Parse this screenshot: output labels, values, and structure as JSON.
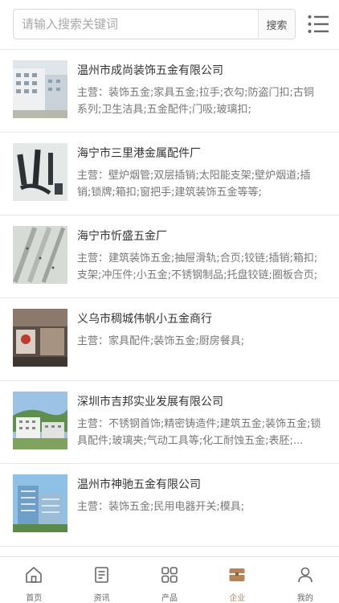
{
  "search": {
    "placeholder": "请输入搜索关键词",
    "button_label": "搜索"
  },
  "companies": [
    {
      "name": "温州市成尚装饰五金有限公司",
      "description": "主营：装饰五金;家具五金;拉手;衣勾;防盗门扣;古铜系列;卫生洁具;五金配件;门吸;玻璃扣;"
    },
    {
      "name": "海宁市三里港金属配件厂",
      "description": "主营：壁炉烟管;双层插销;太阳能支架;壁炉烟道;插销;锁牌;箱扣;窗把手;建筑装饰五金等等;"
    },
    {
      "name": "海宁市忻盛五金厂",
      "description": "主营：建筑装饰五金;抽屉滑轨;合页;铰链;插销;箱扣;支架;冲压件;小五金;不锈钢制品;托盘铰链;圈板合页;"
    },
    {
      "name": "义乌市稠城伟帆小五金商行",
      "description": "主营：家具配件;装饰五金;厨房餐具;"
    },
    {
      "name": "深圳市吉邦实业发展有限公司",
      "description": "主营：不锈钢首饰;精密铸造件;建筑五金;装饰五金;锁具配件;玻璃夹;气动工具等;化工耐蚀五金;表胚;..."
    },
    {
      "name": "温州市神驰五金有限公司",
      "description": "主营：装饰五金;民用电器开关;模具;"
    }
  ],
  "tabs": [
    {
      "label": "首页",
      "icon": "home-icon"
    },
    {
      "label": "资讯",
      "icon": "news-icon"
    },
    {
      "label": "产品",
      "icon": "grid-icon"
    },
    {
      "label": "企业",
      "icon": "company-icon"
    },
    {
      "label": "我的",
      "icon": "user-icon"
    }
  ],
  "colors": {
    "accent": "#b5845a",
    "border": "#e6e6e6",
    "text": "#333333",
    "muted": "#777777"
  }
}
